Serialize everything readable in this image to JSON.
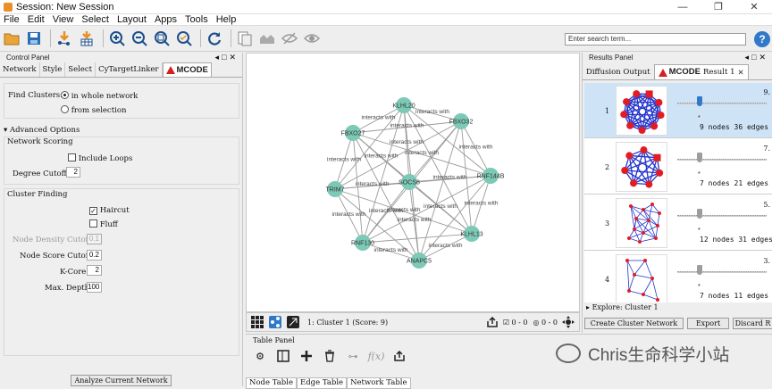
{
  "window": {
    "title": "Session: New Session",
    "controls": [
      "—",
      "❐",
      "✕"
    ]
  },
  "menu": [
    "File",
    "Edit",
    "View",
    "Select",
    "Layout",
    "Apps",
    "Tools",
    "Help"
  ],
  "search": {
    "placeholder": "Enter search term..."
  },
  "help_label": "?",
  "control_panel": {
    "title": "Control Panel",
    "tabs": [
      "Network",
      "Style",
      "Select",
      "CyTargetLinker"
    ],
    "active_tab": "MCODE",
    "find_clusters_label": "Find Clusters:",
    "find_options": [
      "in whole network",
      "from selection"
    ],
    "advanced_label": "Advanced Options",
    "network_scoring_label": "Network Scoring",
    "include_loops_label": "Include Loops",
    "degree_cutoff_label": "Degree Cutoff:",
    "degree_cutoff_value": "2",
    "cluster_finding_label": "Cluster Finding",
    "haircut_label": "Haircut",
    "fluff_label": "Fluff",
    "node_density_label": "Node Density Cutoff:",
    "node_density_value": "0.1",
    "node_score_label": "Node Score Cutoff:",
    "node_score_value": "0.2",
    "kcore_label": "K-Core:",
    "kcore_value": "2",
    "max_depth_label": "Max. Depth:",
    "max_depth_value": "100",
    "analyze_button": "Analyze Current Network"
  },
  "network": {
    "nodes": [
      "KLHL20",
      "FBXO32",
      "FBXO27",
      "RNF144B",
      "TRIM7",
      "SOCS6",
      "KLHL13",
      "RNF130",
      "ANAPC5"
    ],
    "edge_label": "interacts with",
    "center_label": "UBR..SOCS.."
  },
  "netbar": {
    "status": "1: Cluster 1 (Score: 9)",
    "counter1": "0 - 0",
    "counter2": "0 - 0"
  },
  "results_panel": {
    "title": "Results Panel",
    "tabs": [
      "Diffusion Output"
    ],
    "active_tab_label": "Result 1",
    "clusters": [
      {
        "rank": "1",
        "score": "9.",
        "stats": "9 nodes  36 edges"
      },
      {
        "rank": "2",
        "score": "7.",
        "stats": "7 nodes  21 edges"
      },
      {
        "rank": "3",
        "score": "5.",
        "stats": "12 nodes  31 edges"
      },
      {
        "rank": "4",
        "score": "3.",
        "stats": "7 nodes  11 edges"
      }
    ],
    "explore_label": "Explore: Cluster 1",
    "buttons": [
      "Create Cluster Network",
      "Export",
      "Discard R"
    ]
  },
  "table_panel": {
    "title": "Table Panel",
    "tabs": [
      "Node Table",
      "Edge Table",
      "Network Table"
    ]
  },
  "watermark": "Chris生命科学小站",
  "colors": {
    "node": "#7dc9b7",
    "accent": "#2f79c8",
    "cluster_edge": "#2233cc",
    "cluster_node": "#e31b23"
  }
}
